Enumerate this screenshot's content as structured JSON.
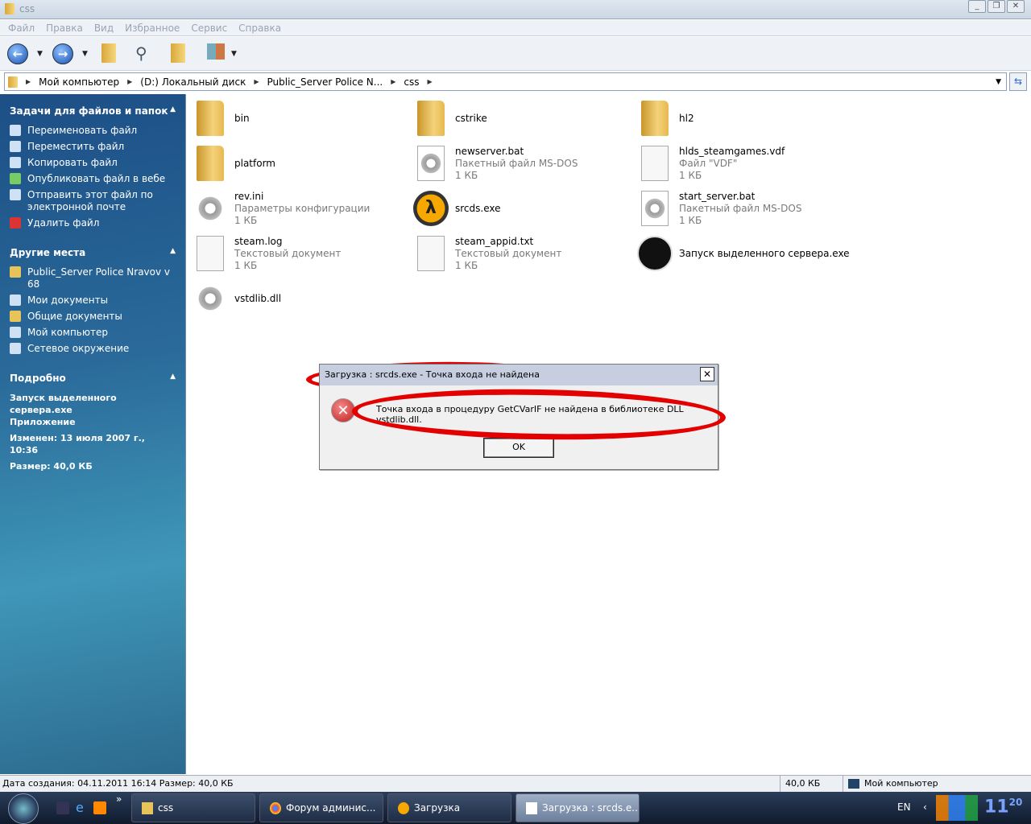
{
  "window": {
    "title": "css"
  },
  "menu": [
    "Файл",
    "Правка",
    "Вид",
    "Избранное",
    "Сервис",
    "Справка"
  ],
  "address": {
    "crumbs": [
      "Мой компьютер",
      "(D:) Локальный диск",
      "Public_Server Police N...",
      "css"
    ]
  },
  "sidebar": {
    "tasks": {
      "title": "Задачи для файлов и папок",
      "items": [
        "Переименовать файл",
        "Переместить файл",
        "Копировать файл",
        "Опубликовать файл в вебе",
        "Отправить этот файл по электронной почте",
        "Удалить файл"
      ]
    },
    "places": {
      "title": "Другие места",
      "items": [
        "Public_Server Police Nravov v 68",
        "Мои документы",
        "Общие документы",
        "Мой компьютер",
        "Сетевое окружение"
      ]
    },
    "details": {
      "title": "Подробно",
      "name": "Запуск выделенного сервера.exe",
      "type": "Приложение",
      "modified": "Изменен: 13 июля 2007 г., 10:36",
      "size": "Размер: 40,0 КБ"
    }
  },
  "files": [
    {
      "name": "bin",
      "icon": "folder"
    },
    {
      "name": "cstrike",
      "icon": "folder"
    },
    {
      "name": "hl2",
      "icon": "folder"
    },
    {
      "name": "platform",
      "icon": "folder"
    },
    {
      "name": "newserver.bat",
      "type": "Пакетный файл MS-DOS",
      "size": "1 КБ",
      "icon": "bat"
    },
    {
      "name": "hlds_steamgames.vdf",
      "type": "Файл \"VDF\"",
      "size": "1 КБ",
      "icon": "vdf"
    },
    {
      "name": "rev.ini",
      "type": "Параметры конфигурации",
      "size": "1 КБ",
      "icon": "ini"
    },
    {
      "name": "srcds.exe",
      "icon": "half-life"
    },
    {
      "name": "start_server.bat",
      "type": "Пакетный файл MS-DOS",
      "size": "1 КБ",
      "icon": "bat"
    },
    {
      "name": "steam.log",
      "type": "Текстовый документ",
      "size": "1 КБ",
      "icon": "text"
    },
    {
      "name": "steam_appid.txt",
      "type": "Текстовый документ",
      "size": "1 КБ",
      "icon": "text"
    },
    {
      "name": "Запуск выделенного сервера.exe",
      "icon": "steam"
    },
    {
      "name": "vstdlib.dll",
      "icon": "dll"
    }
  ],
  "dialog": {
    "title": "Загрузка : srcds.exe - Точка входа не найдена",
    "message": "Точка входа в процедуру GetCVarIF не найдена в библиотеке DLL vstdlib.dll.",
    "ok": "OK",
    "annotation_color": "#e30000"
  },
  "status": {
    "info": "Дата создания: 04.11.2011 16:14 Размер: 40,0 КБ",
    "size": "40,0 КБ",
    "location": "Мой компьютер"
  },
  "taskbar": {
    "tasks": [
      "css",
      "Форум админис...",
      "Загрузка",
      "Загрузка : srcds.e..."
    ],
    "lang": "EN",
    "clock": "11",
    "clock_sup": "20"
  }
}
